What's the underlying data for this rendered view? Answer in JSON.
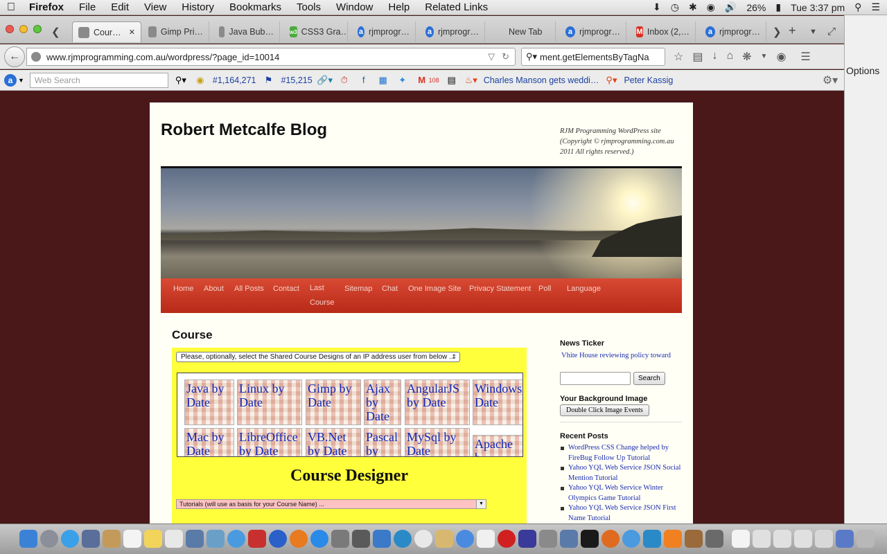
{
  "menubar": {
    "items": [
      "Firefox",
      "File",
      "Edit",
      "View",
      "History",
      "Bookmarks",
      "Tools",
      "Window",
      "Help",
      "Related Links"
    ],
    "battery": "26%",
    "clock": "Tue 3:37 pm"
  },
  "tabs": [
    {
      "label": "Cour…",
      "icon": "page-icon",
      "color": "#8a8a8a"
    },
    {
      "label": "Gimp Pri…",
      "icon": "page-icon",
      "color": "#8a8a8a"
    },
    {
      "label": "Java Bub…",
      "icon": "page-icon",
      "color": "#8a8a8a"
    },
    {
      "label": "CSS3 Gra…",
      "icon": "w3-icon",
      "color": "#4caa3c"
    },
    {
      "label": "rjmprogr…",
      "icon": "a-icon",
      "color": "#2a6fd6"
    },
    {
      "label": "rjmprogr…",
      "icon": "a-icon",
      "color": "#2a6fd6"
    },
    {
      "label": "New Tab",
      "icon": "",
      "color": ""
    },
    {
      "label": "rjmprogr…",
      "icon": "a-icon",
      "color": "#2a6fd6"
    },
    {
      "label": "Inbox (2,…",
      "icon": "gmail-icon",
      "color": "#d93025"
    },
    {
      "label": "rjmprogr…",
      "icon": "a-icon",
      "color": "#2a6fd6"
    }
  ],
  "nav": {
    "url": "www.rjmprogramming.com.au/wordpress/?page_id=10014",
    "search_value": "ment.getElementsByTagNa"
  },
  "toolbar2": {
    "web_search_placeholder": "Web Search",
    "rank1": "#1,164,271",
    "rank2": "#15,215",
    "news1": "Charles Manson gets weddi…",
    "news2": "Peter Kassig",
    "gmail_badge": "108"
  },
  "bgwindow": {
    "options": "Options"
  },
  "site": {
    "title": "Robert Metcalfe Blog",
    "description": "RJM Programming WordPress site (Copyright © rjmprogramming.com.au 2011 All rights reserved.)",
    "menu": [
      "Home",
      "About",
      "All Posts",
      "Contact",
      "Last Course",
      "Sitemap",
      "Chat",
      "One Image Site",
      "Privacy Statement",
      "Poll",
      "Language"
    ]
  },
  "content": {
    "title": "Course",
    "shared_select": "Please, optionally, select the Shared Course Designs of an IP address user from below ...",
    "cells_row1": [
      "Java by Date",
      "Linux by Date",
      "Gimp by Date",
      "Ajax by Date",
      "AngularJS by Date",
      "Windows Date"
    ],
    "cells_row2": [
      "Mac by Date",
      "LibreOffice by Date",
      "VB.Net by Date",
      "Pascal by",
      "MySql by Date",
      "Apache b"
    ],
    "designer_title": "Course Designer",
    "tutorials_select": "Tutorials (will use as basis for your Course Name) ..."
  },
  "sidebar": {
    "news_heading": "News Ticker",
    "ticker_text": "Vhite House reviewing policy toward",
    "search_button": "Search",
    "bg_heading": "Your Background Image",
    "bg_button": "Double Click Image Events",
    "recent_heading": "Recent Posts",
    "recent_posts": [
      "WordPress CSS Change helped by FireBug Follow Up Tutorial",
      "Yahoo YQL Web Service JSON Social Mention Tutorial",
      "Yahoo YQL Web Service Winter Olympics Game Tutorial",
      "Yahoo YQL Web Service JSON First Name Tutorial"
    ]
  }
}
